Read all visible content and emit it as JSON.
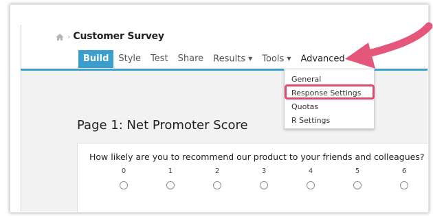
{
  "breadcrumb": {
    "title": "Customer Survey"
  },
  "tabs": [
    {
      "label": "Build"
    },
    {
      "label": "Style"
    },
    {
      "label": "Test"
    },
    {
      "label": "Share"
    },
    {
      "label": "Results"
    },
    {
      "label": "Tools"
    },
    {
      "label": "Advanced"
    }
  ],
  "advanced_menu": {
    "items": [
      {
        "label": "General"
      },
      {
        "label": "Response Settings"
      },
      {
        "label": "Quotas"
      },
      {
        "label": "R Settings"
      }
    ]
  },
  "page": {
    "title": "Page 1: Net Promoter Score"
  },
  "question": {
    "text": "How likely are you to recommend our product to your friends and colleagues?",
    "scale": [
      "0",
      "1",
      "2",
      "3",
      "4",
      "5",
      "6"
    ]
  },
  "colors": {
    "accent": "#3a9fcf",
    "highlight": "#dc4b6e"
  }
}
